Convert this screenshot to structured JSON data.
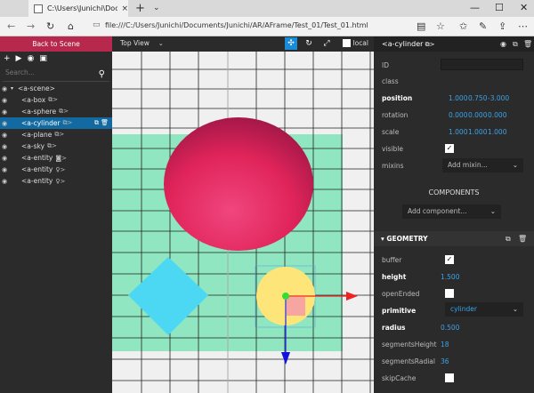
{
  "browser": {
    "tab_title": "C:\\Users\\Junichi\\Docum",
    "tab_close": "×",
    "new_tab": "+",
    "tab_dropdown": "⌄",
    "minimize": "—",
    "maximize": "☐",
    "close": "✕",
    "url": "file:///C:/Users/Junichi/Documents/Junichi/AR/AFrame/Test_01/Test_01.html"
  },
  "left_panel": {
    "back_label": "Back to Scene",
    "search_placeholder": "Search...",
    "tree": [
      {
        "label": "<a-scene>",
        "indent": 0,
        "icon": ""
      },
      {
        "label": "<a-box",
        "indent": 1,
        "icon": "cube-icon"
      },
      {
        "label": "<a-sphere",
        "indent": 1,
        "icon": "cube-icon"
      },
      {
        "label": "<a-cylinder",
        "indent": 1,
        "icon": "cube-icon",
        "selected": true
      },
      {
        "label": "<a-plane",
        "indent": 1,
        "icon": "cube-icon"
      },
      {
        "label": "<a-sky",
        "indent": 1,
        "icon": "cube-icon"
      },
      {
        "label": "<a-entity",
        "indent": 1,
        "icon": "camera-icon"
      },
      {
        "label": "<a-entity",
        "indent": 1,
        "icon": "bulb-icon"
      },
      {
        "label": "<a-entity",
        "indent": 1,
        "icon": "bulb-icon"
      }
    ]
  },
  "viewport": {
    "view_label": "Top View",
    "local_label": "local"
  },
  "right_panel": {
    "entity_title": "<a-cylinder",
    "id_label": "ID",
    "class_label": "class",
    "position_label": "position",
    "position": [
      "1.000",
      "0.750",
      "-3.000"
    ],
    "rotation_label": "rotation",
    "rotation": [
      "0.000",
      "0.000",
      "0.000"
    ],
    "scale_label": "scale",
    "scale": [
      "1.000",
      "1.000",
      "1.000"
    ],
    "visible_label": "visible",
    "mixins_label": "mixins",
    "mixins_placeholder": "Add mixin...",
    "components_title": "COMPONENTS",
    "add_component": "Add component...",
    "geometry_title": "GEOMETRY",
    "buffer_label": "buffer",
    "height_label": "height",
    "height_value": "1.500",
    "openended_label": "openEnded",
    "primitive_label": "primitive",
    "primitive_value": "cylinder",
    "radius_label": "radius",
    "radius_value": "0.500",
    "segmentsheight_label": "segmentsHeight",
    "segmentsheight_value": "18",
    "segmentsradial_label": "segmentsRadial",
    "segmentsradial_value": "36",
    "skipcache_label": "skipCache"
  }
}
